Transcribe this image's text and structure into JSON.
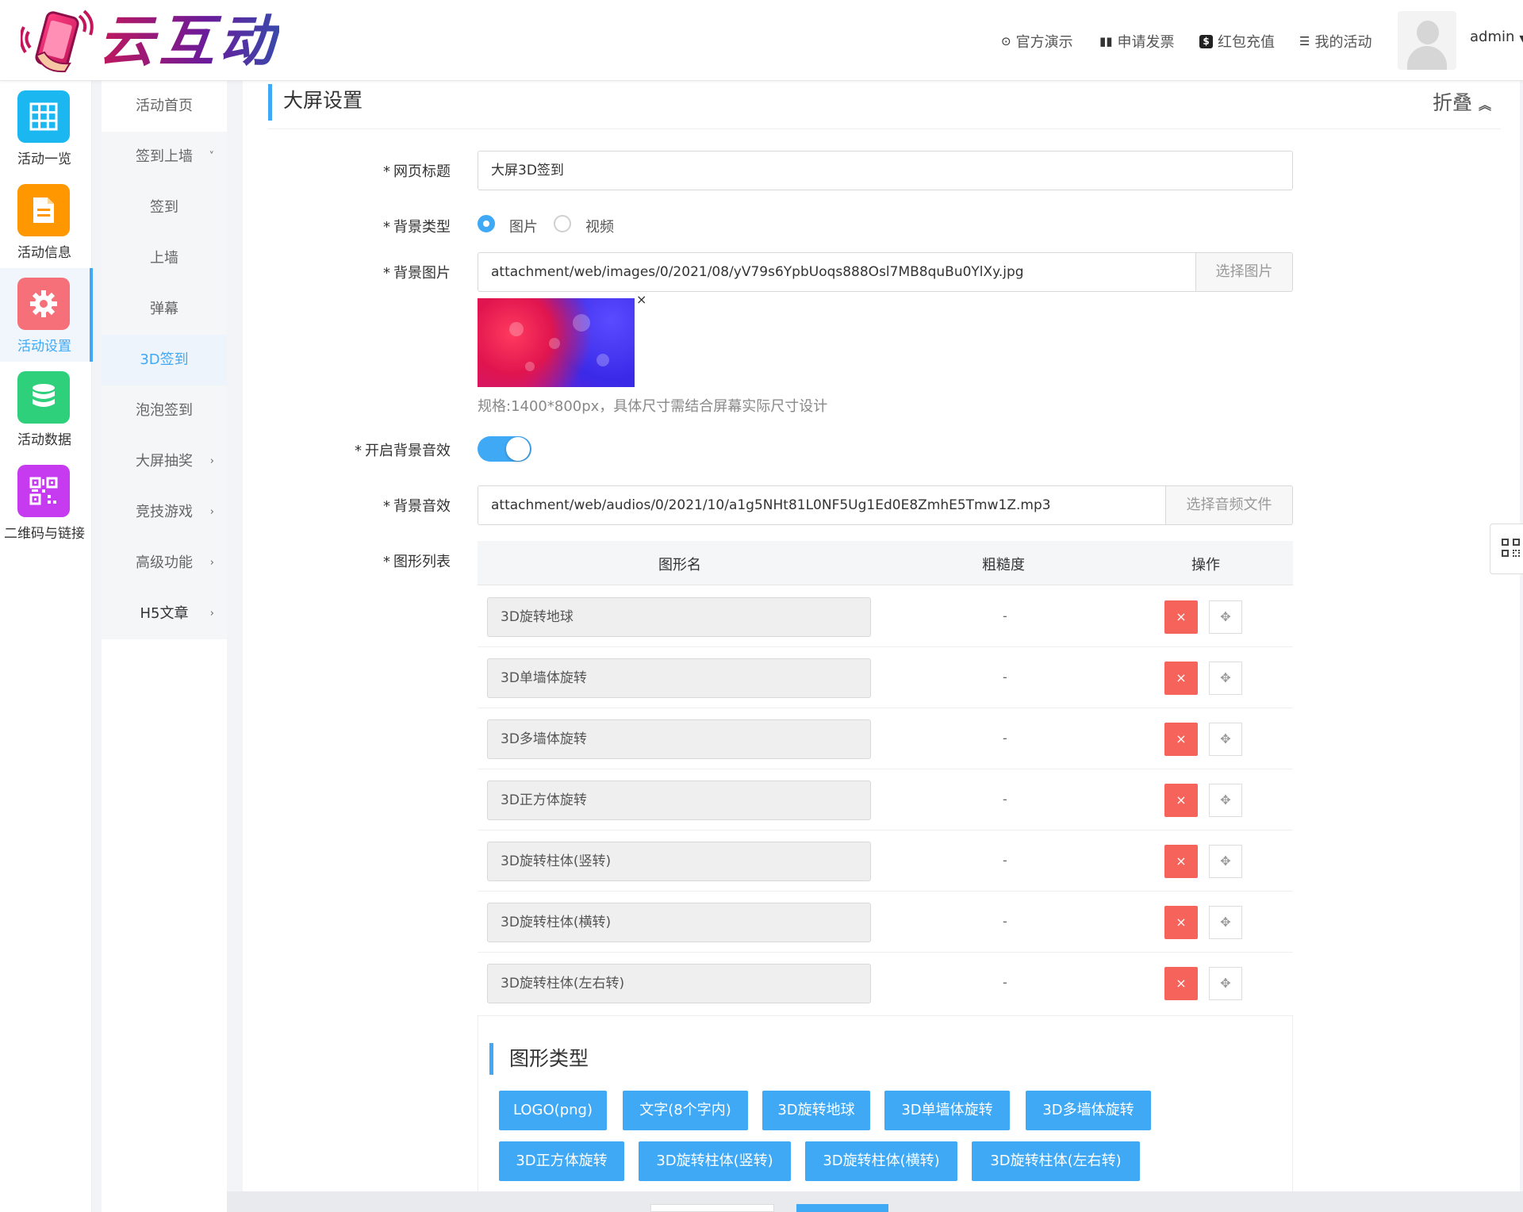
{
  "brand": {
    "logo_text": "云互动"
  },
  "topnav": [
    {
      "icon": "play-circle-icon",
      "label": "官方演示"
    },
    {
      "icon": "barcode-icon",
      "label": "申请发票"
    },
    {
      "icon": "dollar-box-icon",
      "label": "红包充值"
    },
    {
      "icon": "list-icon",
      "label": "我的活动"
    }
  ],
  "user": {
    "name": "admin"
  },
  "sidebar1": [
    {
      "label": "活动一览",
      "icon": "grid-icon",
      "color": "#1bb7f0"
    },
    {
      "label": "活动信息",
      "icon": "document-icon",
      "color": "#ff9800"
    },
    {
      "label": "活动设置",
      "icon": "gear-icon",
      "color": "#f6707a",
      "active": true
    },
    {
      "label": "活动数据",
      "icon": "database-icon",
      "color": "#2fd07c"
    },
    {
      "label": "二维码与链接",
      "icon": "qrcode-icon",
      "color": "#c63bf0"
    }
  ],
  "sidebar2": [
    {
      "label": "活动首页"
    },
    {
      "label": "签到上墙",
      "arrow": "˅"
    },
    {
      "label": "签到"
    },
    {
      "label": "上墙"
    },
    {
      "label": "弹幕"
    },
    {
      "label": "3D签到",
      "active": true
    },
    {
      "label": "泡泡签到"
    },
    {
      "label": "大屏抽奖",
      "arrow": "›"
    },
    {
      "label": "竞技游戏",
      "arrow": "›"
    },
    {
      "label": "高级功能",
      "arrow": "›"
    },
    {
      "label": "H5文章",
      "arrow": "›"
    }
  ],
  "section": {
    "title": "大屏设置",
    "fold_label": "折叠",
    "fold_icon": "»"
  },
  "form": {
    "page_title": {
      "label": "网页标题",
      "value": "大屏3D签到"
    },
    "bg_type": {
      "label": "背景类型",
      "options": [
        "图片",
        "视频"
      ],
      "selected": "图片"
    },
    "bg_image": {
      "label": "背景图片",
      "value": "attachment/web/images/0/2021/08/yV79s6YpbUoqs888Osl7MB8quBu0YlXy.jpg",
      "button": "选择图片",
      "remove": "×",
      "hint": "规格:1400*800px，具体尺寸需结合屏幕实际尺寸设计"
    },
    "bg_music_enabled": {
      "label": "开启背景音效",
      "on": true
    },
    "bg_music": {
      "label": "背景音效",
      "value": "attachment/web/audios/0/2021/10/a1g5NHt81L0NF5Ug1Ed0E8ZmhE5Tmw1Z.mp3",
      "button": "选择音频文件"
    },
    "shape_list": {
      "label": "图形列表"
    }
  },
  "table": {
    "headers": [
      "图形名",
      "粗糙度",
      "操作"
    ],
    "rows": [
      {
        "name": "3D旋转地球",
        "roughness": "-"
      },
      {
        "name": "3D单墙体旋转",
        "roughness": "-"
      },
      {
        "name": "3D多墙体旋转",
        "roughness": "-"
      },
      {
        "name": "3D正方体旋转",
        "roughness": "-"
      },
      {
        "name": "3D旋转柱体(竖转)",
        "roughness": "-"
      },
      {
        "name": "3D旋转柱体(横转)",
        "roughness": "-"
      },
      {
        "name": "3D旋转柱体(左右转)",
        "roughness": "-"
      }
    ],
    "delete_symbol": "×",
    "drag_symbol": "✥"
  },
  "shape_types": {
    "title": "图形类型",
    "buttons": [
      "LOGO(png)",
      "文字(8个字内)",
      "3D旋转地球",
      "3D单墙体旋转",
      "3D多墙体旋转",
      "3D正方体旋转",
      "3D旋转柱体(竖转)",
      "3D旋转柱体(横转)",
      "3D旋转柱体(左右转)"
    ]
  },
  "colors": {
    "accent": "#3fa9f5",
    "danger": "#f5635a"
  }
}
